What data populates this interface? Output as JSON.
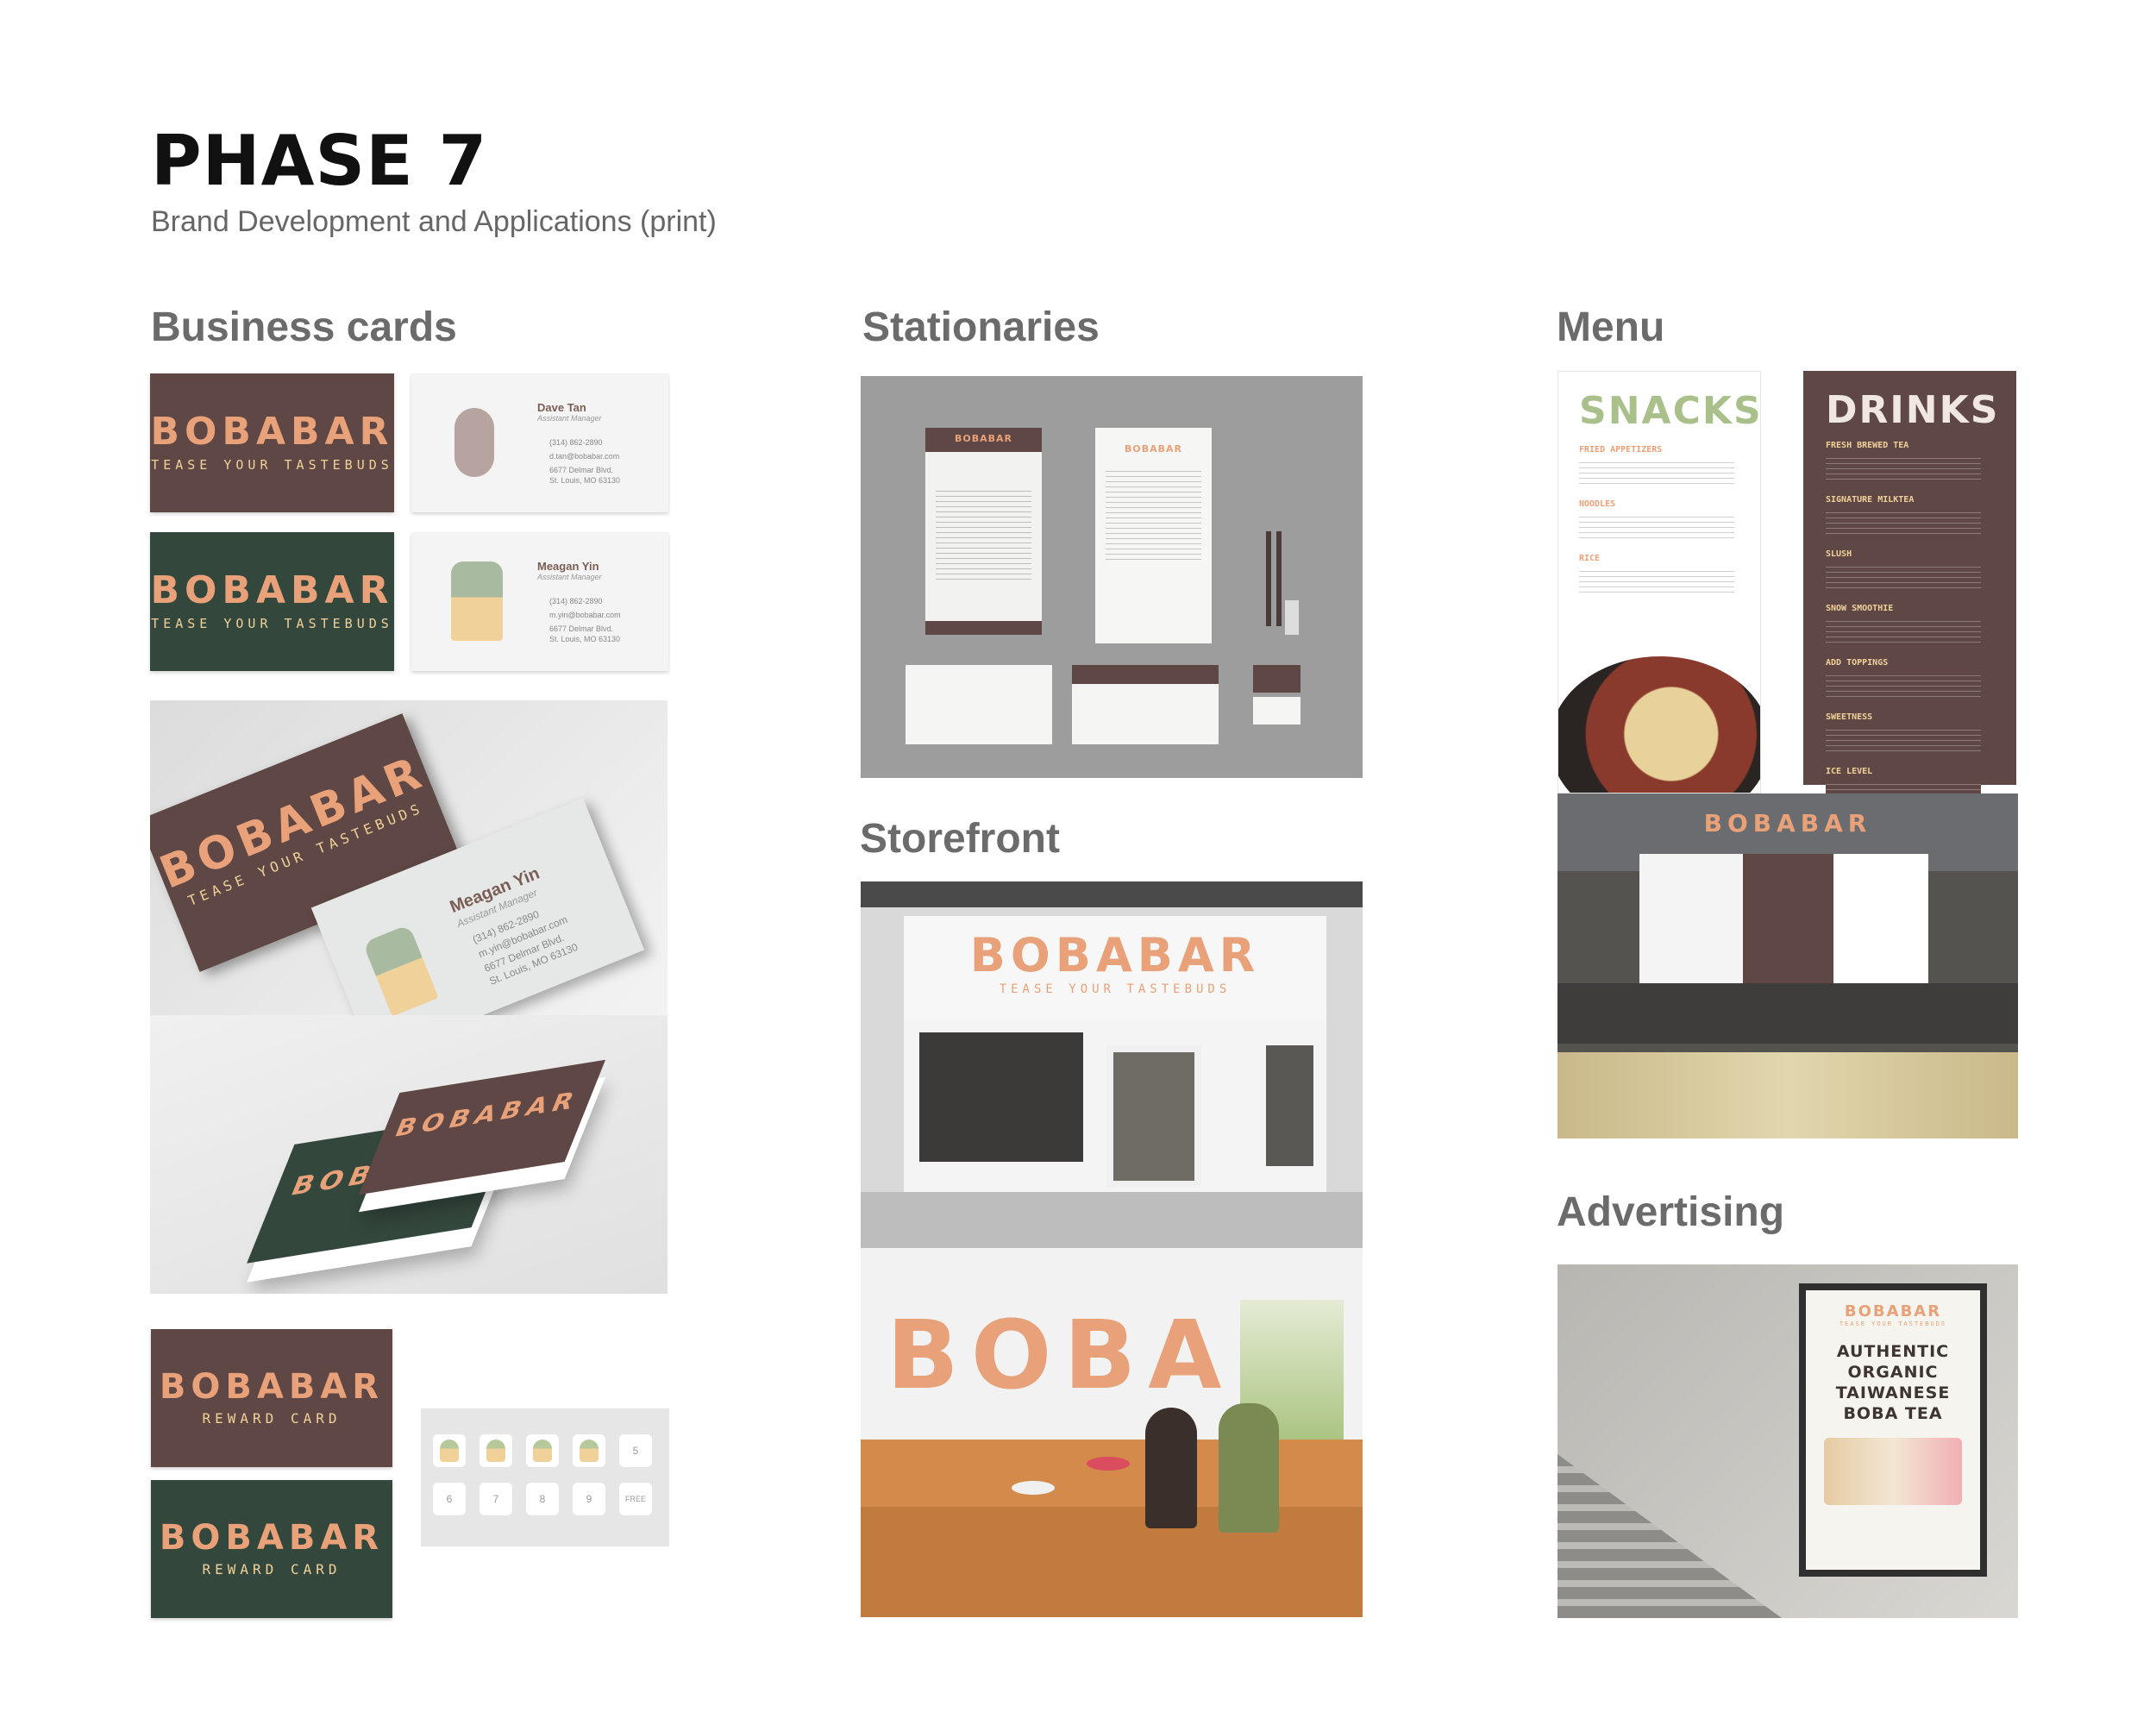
{
  "header": {
    "title": "PHASE 7",
    "subtitle": "Brand Development and Applications (print)"
  },
  "sections": {
    "business_cards": "Business cards",
    "stationaries": "Stationaries",
    "menu": "Menu",
    "storefront": "Storefront",
    "advertising": "Advertising"
  },
  "brand": {
    "logo": "BOBABAR",
    "tagline": "TEASE YOUR TASTEBUDS",
    "reward": "REWARD CARD",
    "boba": "BOBA"
  },
  "contacts": [
    {
      "name": "Dave Tan",
      "role": "Assistant Manager",
      "phone": "(314) 862-2890",
      "email": "d.tan@bobabar.com",
      "addr1": "6677 Delmar Blvd.",
      "addr2": "St. Louis, MO 63130"
    },
    {
      "name": "Meagan Yin",
      "role": "Assistant Manager",
      "phone": "(314) 862-2890",
      "email": "m.yin@bobabar.com",
      "addr1": "6677 Delmar Blvd.",
      "addr2": "St. Louis, MO 63130"
    }
  ],
  "reward_slots": [
    "",
    "",
    "",
    "",
    "5",
    "6",
    "7",
    "8",
    "9",
    "FREE"
  ],
  "menu": {
    "snacks_title": "SNACKS",
    "drinks_title": "DRINKS",
    "snacks_sections": [
      "FRIED APPETIZERS",
      "NOODLES",
      "RICE"
    ],
    "drinks_sections": [
      "FRESH BREWED TEA",
      "SIGNATURE MILKTEA",
      "SLUSH",
      "SNOW SMOOTHIE",
      "ADD TOPPINGS",
      "SWEETNESS",
      "ICE LEVEL"
    ]
  },
  "advertising": {
    "headline": [
      "AUTHENTIC",
      "ORGANIC",
      "TAIWANESE",
      "BOBA TEA"
    ]
  },
  "colors": {
    "brown": "#5e4744",
    "green": "#34473d",
    "peach": "#e8a178",
    "cream": "#f1d19a",
    "sage": "#b7c99a"
  }
}
